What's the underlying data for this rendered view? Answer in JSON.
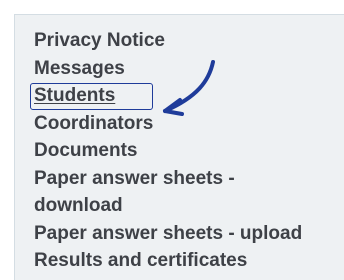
{
  "menu": {
    "items": [
      {
        "label": "Privacy Notice"
      },
      {
        "label": "Messages"
      },
      {
        "label": "Students",
        "selected": true
      },
      {
        "label": "Coordinators"
      },
      {
        "label": "Documents"
      },
      {
        "label": "Paper answer sheets -"
      },
      {
        "label": "download"
      },
      {
        "label": "Paper answer sheets - upload"
      },
      {
        "label": "Results and certificates"
      }
    ]
  },
  "colors": {
    "panel_background": "#eef1f3",
    "menu_text": "#3e4147",
    "annotation_arrow": "#1f3c9a",
    "highlight_box": "#1f3c9a"
  }
}
